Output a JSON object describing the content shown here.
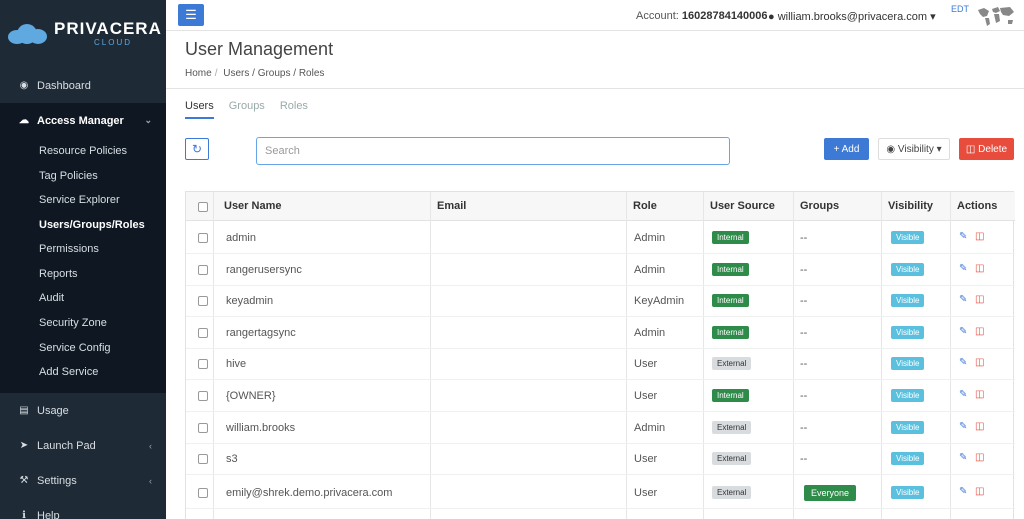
{
  "app": {
    "brand": "PRIVACERA",
    "brand_sub": "CLOUD"
  },
  "sidebar": {
    "dashboard": "Dashboard",
    "access_manager": "Access Manager",
    "sub_items": [
      "Resource Policies",
      "Tag Policies",
      "Service Explorer",
      "Users/Groups/Roles",
      "Permissions",
      "Reports",
      "Audit",
      "Security Zone",
      "Service Config",
      "Add Service"
    ],
    "usage": "Usage",
    "launch_pad": "Launch Pad",
    "settings": "Settings",
    "help": "Help"
  },
  "header": {
    "account_label": "Account:",
    "account_id": "16028784140006",
    "user_email": "william.brooks@privacera.com",
    "timezone": "EDT"
  },
  "page": {
    "title": "User Management",
    "breadcrumb_home": "Home",
    "breadcrumb_current": "Users / Groups / Roles"
  },
  "tabs": [
    "Users",
    "Groups",
    "Roles"
  ],
  "toolbar": {
    "search_placeholder": "Search",
    "add_label": "Add",
    "visibility_label": "Visibility",
    "delete_label": "Delete"
  },
  "table": {
    "headers": [
      "User Name",
      "Email",
      "Role",
      "User Source",
      "Groups",
      "Visibility",
      "Actions"
    ],
    "rows": [
      {
        "name": "admin",
        "email": "",
        "role": "Admin",
        "source": "Internal",
        "groups": "--",
        "visibility": "Visible"
      },
      {
        "name": "rangerusersync",
        "email": "",
        "role": "Admin",
        "source": "Internal",
        "groups": "--",
        "visibility": "Visible"
      },
      {
        "name": "keyadmin",
        "email": "",
        "role": "KeyAdmin",
        "source": "Internal",
        "groups": "--",
        "visibility": "Visible"
      },
      {
        "name": "rangertagsync",
        "email": "",
        "role": "Admin",
        "source": "Internal",
        "groups": "--",
        "visibility": "Visible"
      },
      {
        "name": "hive",
        "email": "",
        "role": "User",
        "source": "External",
        "groups": "--",
        "visibility": "Visible"
      },
      {
        "name": "{OWNER}",
        "email": "",
        "role": "User",
        "source": "Internal",
        "groups": "--",
        "visibility": "Visible"
      },
      {
        "name": "william.brooks",
        "email": "",
        "role": "Admin",
        "source": "External",
        "groups": "--",
        "visibility": "Visible"
      },
      {
        "name": "s3",
        "email": "",
        "role": "User",
        "source": "External",
        "groups": "--",
        "visibility": "Visible"
      },
      {
        "name": "emily@shrek.demo.privacera.com",
        "email": "",
        "role": "User",
        "source": "External",
        "groups": "Everyone",
        "visibility": "Visible"
      }
    ]
  },
  "colors": {
    "sidebar_bg": "#1e2a36",
    "accent": "#3d7ad6",
    "internal": "#2e8b4a",
    "visible": "#5bc0de",
    "danger": "#e74c3c"
  }
}
